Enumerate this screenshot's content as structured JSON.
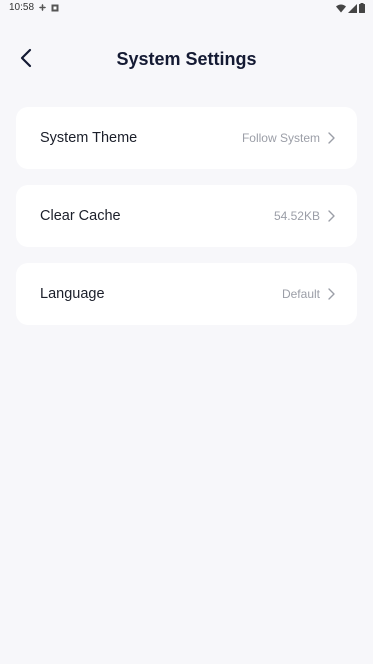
{
  "status_bar": {
    "time": "10:58"
  },
  "header": {
    "title": "System Settings"
  },
  "settings": [
    {
      "label": "System Theme",
      "value": "Follow System"
    },
    {
      "label": "Clear Cache",
      "value": "54.52KB"
    },
    {
      "label": "Language",
      "value": "Default"
    }
  ],
  "icons": {
    "back": "chevron-left-icon",
    "row_arrow": "chevron-right-icon"
  },
  "colors": {
    "background": "#f7f7fa",
    "card": "#ffffff",
    "title": "#141a33",
    "secondary_text": "#9b9ea7"
  }
}
